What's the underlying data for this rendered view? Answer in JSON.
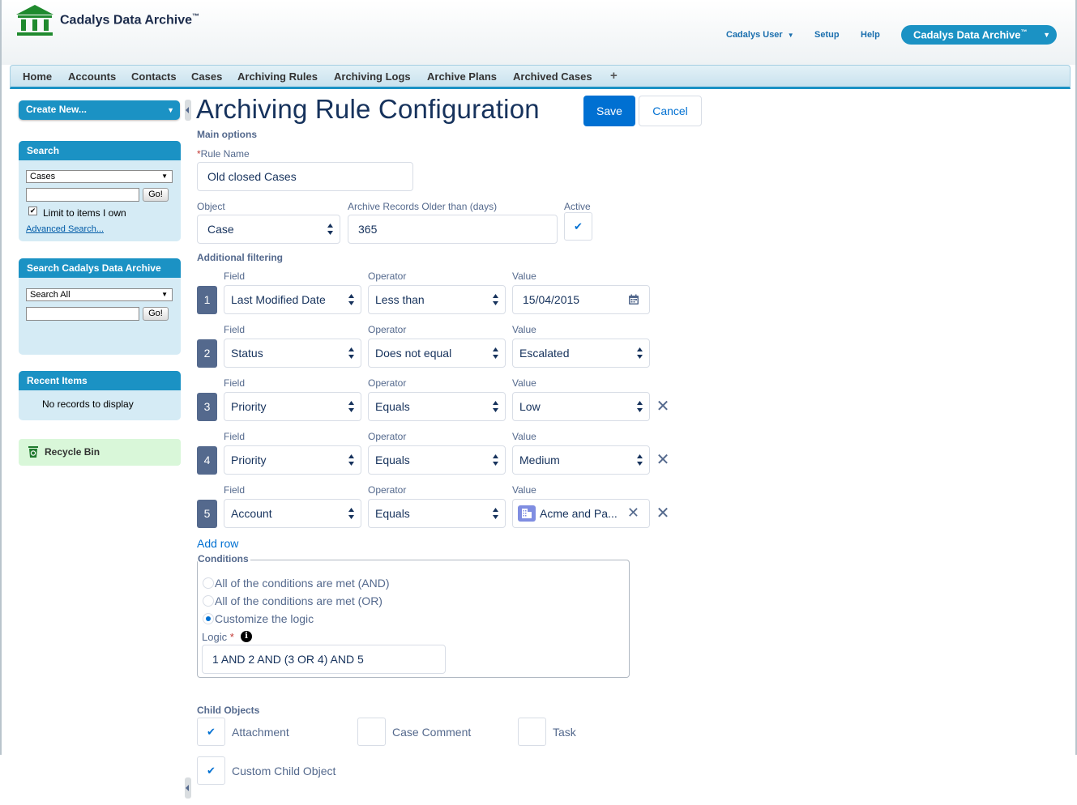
{
  "header": {
    "brand": "Cadalys Data Archive",
    "brand_tm": "™",
    "user_menu": "Cadalys User",
    "setup": "Setup",
    "help": "Help",
    "app_menu": "Cadalys Data Archive",
    "app_menu_tm": "™"
  },
  "tabs": [
    "Home",
    "Accounts",
    "Contacts",
    "Cases",
    "Archiving Rules",
    "Archiving Logs",
    "Archive Plans",
    "Archived Cases"
  ],
  "tab_plus": "+",
  "sidebar": {
    "create_new": "Create New...",
    "search": {
      "title": "Search",
      "scope": "Cases",
      "go": "Go!",
      "limit_label": "Limit to items I own",
      "limit_checked": true,
      "advanced": "Advanced Search..."
    },
    "archive_search": {
      "title": "Search Cadalys Data Archive",
      "scope": "Search All",
      "go": "Go!"
    },
    "recent": {
      "title": "Recent Items",
      "empty": "No records to display"
    },
    "recycle_bin": "Recycle Bin"
  },
  "form": {
    "title": "Archiving Rule Configuration",
    "save": "Save",
    "cancel": "Cancel",
    "main_options": "Main options",
    "rule_name_label": "Rule Name",
    "rule_name_required": "*",
    "rule_name": "Old closed Cases",
    "object_label": "Object",
    "object": "Case",
    "older_label": "Archive Records Older than (days)",
    "older": "365",
    "active_label": "Active",
    "active": true,
    "additional_filtering": "Additional filtering",
    "field_header": "Field",
    "operator_header": "Operator",
    "value_header": "Value",
    "filters": [
      {
        "num": "1",
        "field": "Last Modified Date",
        "operator": "Less than",
        "value": "15/04/2015"
      },
      {
        "num": "2",
        "field": "Status",
        "operator": "Does not equal",
        "value": "Escalated"
      },
      {
        "num": "3",
        "field": "Priority",
        "operator": "Equals",
        "value": "Low"
      },
      {
        "num": "4",
        "field": "Priority",
        "operator": "Equals",
        "value": "Medium"
      },
      {
        "num": "5",
        "field": "Account",
        "operator": "Equals",
        "value": "Acme and Pa..."
      }
    ],
    "add_row": "Add row",
    "conditions": {
      "legend": "Conditions",
      "options": [
        "All of the conditions are met (AND)",
        "All of the conditions are met (OR)",
        "Customize the logic"
      ],
      "selected": 2,
      "logic_label": "Logic",
      "logic_required": "*",
      "logic": "1 AND 2 AND (3 OR 4) AND 5"
    },
    "child_objects": {
      "title": "Child Objects",
      "items": [
        {
          "label": "Attachment",
          "checked": true
        },
        {
          "label": "Case Comment",
          "checked": false
        },
        {
          "label": "Task",
          "checked": false
        },
        {
          "label": "Custom Child Object",
          "checked": true
        }
      ]
    }
  },
  "icons": {
    "logo": "bank-building-icon",
    "calendar": "calendar-icon",
    "lookup": "account-building-icon",
    "recycle": "recycle-bin-icon",
    "info": "info-icon",
    "remove": "close-icon"
  },
  "colors": {
    "brand_blue": "#1b92c4",
    "save_blue": "#0070d2",
    "text_navy": "#16325c",
    "label_gray": "#54698d",
    "logo_green": "#1f8a2e",
    "sidebar_bg": "#d5ebf5",
    "recycle_bg": "#d9f7d9"
  }
}
